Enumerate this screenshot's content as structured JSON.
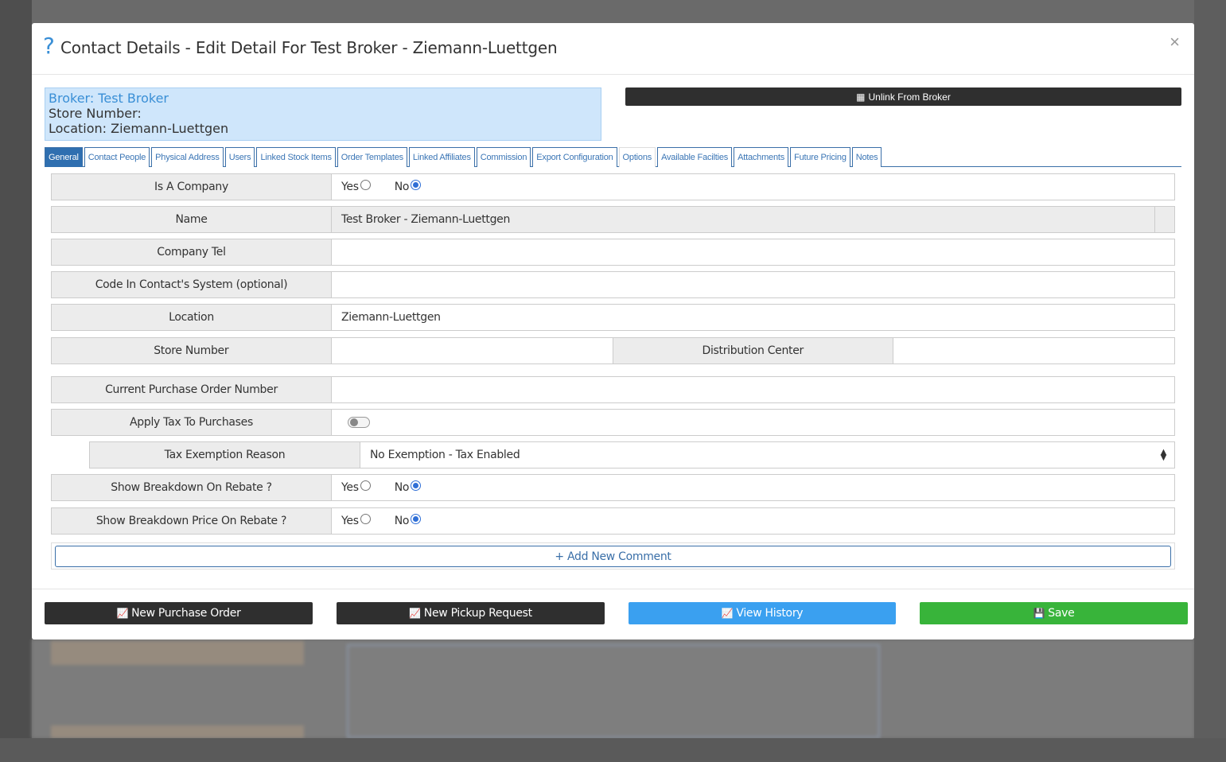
{
  "modal": {
    "help_icon": "?",
    "title": "Contact Details - Edit Detail For Test Broker - Ziemann-Luettgen",
    "close_icon": "×"
  },
  "info": {
    "broker": "Broker: Test Broker",
    "store_number": "Store Number:",
    "location": "Location: Ziemann-Luettgen"
  },
  "unlink_button": {
    "icon": "building-icon",
    "label": "Unlink From Broker"
  },
  "tabs": [
    "General",
    "Contact People",
    "Physical Address",
    "Users",
    "Linked Stock Items",
    "Order Templates",
    "Linked Affiliates",
    "Commission",
    "Export Configuration",
    "Options",
    "Available Facilties",
    "Attachments",
    "Future Pricing",
    "Notes"
  ],
  "fields": {
    "is_company": {
      "label": "Is A Company",
      "yes": "Yes",
      "no": "No",
      "selected": "No"
    },
    "name": {
      "label": "Name",
      "value": "Test Broker - Ziemann-Luettgen"
    },
    "company_tel": {
      "label": "Company Tel",
      "value": ""
    },
    "code": {
      "label": "Code In Contact's System (optional)",
      "value": ""
    },
    "location": {
      "label": "Location",
      "value": "Ziemann-Luettgen"
    },
    "store_number": {
      "label": "Store Number",
      "value": ""
    },
    "distribution_center": {
      "label": "Distribution Center",
      "value": ""
    },
    "po_number": {
      "label": "Current Purchase Order Number",
      "value": ""
    },
    "apply_tax": {
      "label": "Apply Tax To Purchases",
      "enabled": false
    },
    "tax_exemption": {
      "label": "Tax Exemption Reason",
      "value": "No Exemption - Tax Enabled"
    },
    "breakdown_rebate": {
      "label": "Show Breakdown On Rebate ?",
      "yes": "Yes",
      "no": "No",
      "selected": "No"
    },
    "breakdown_price_rebate": {
      "label": "Show Breakdown Price On Rebate ?",
      "yes": "Yes",
      "no": "No",
      "selected": "No"
    }
  },
  "add_comment": {
    "icon": "+",
    "label": "Add New Comment"
  },
  "footer": {
    "new_po": "New Purchase Order",
    "new_pickup": "New Pickup Request",
    "view_history": "View History",
    "save": "Save"
  },
  "colors": {
    "accent_blue": "#2f6fb0",
    "history_blue": "#3aa0f0",
    "save_green": "#38b43a",
    "dark_button": "#2f2f2f",
    "info_box": "#cfe6fb"
  }
}
